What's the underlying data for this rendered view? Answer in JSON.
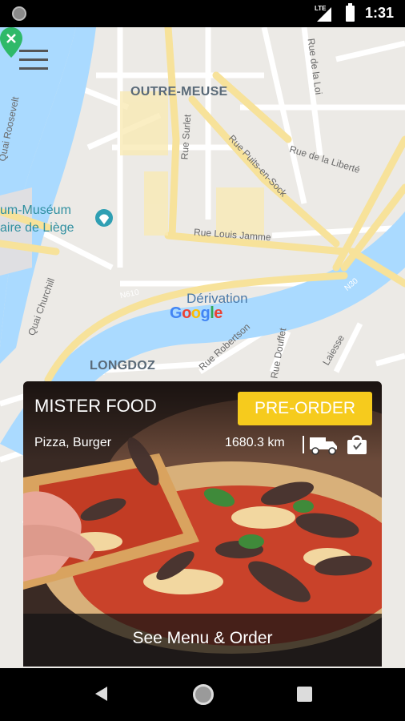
{
  "status_bar": {
    "network": "LTE",
    "time": "1:31"
  },
  "map": {
    "districts": {
      "north": "OUTRE-MEUSE",
      "south": "LONGDOZ"
    },
    "water_label": "Dérivation",
    "museum_label_line1": "um-Muséum",
    "museum_label_line2": "aire de Liège",
    "streets": {
      "quai_roosevelt": "Quai Roosevelt",
      "quai_churchill": "Quai Churchill",
      "rue_surlet": "Rue Surlet",
      "rue_puits": "Rue Puits-en-Sock",
      "rue_liberte": "Rue de la Liberté",
      "rue_loi": "Rue de la Loi",
      "rue_louis_jamme": "Rue Louis Jamme",
      "rue_robertson": "Rue Robertson",
      "rue_douffet": "Rue Douffet",
      "laiesse": "Laiesse",
      "route_n610": "N610",
      "route_n30": "N30"
    },
    "attribution": "Google"
  },
  "restaurant": {
    "name": "MISTER FOOD",
    "cuisine": "Pizza, Burger",
    "distance": "1680.3 km",
    "preorder_label": "PRE-ORDER",
    "menu_label": "See Menu & Order"
  },
  "colors": {
    "accent": "#f6cb1d",
    "water": "#aadaff",
    "map_bg": "#eceae6",
    "road_major": "#f7e29a",
    "pin": "#2fb969"
  }
}
